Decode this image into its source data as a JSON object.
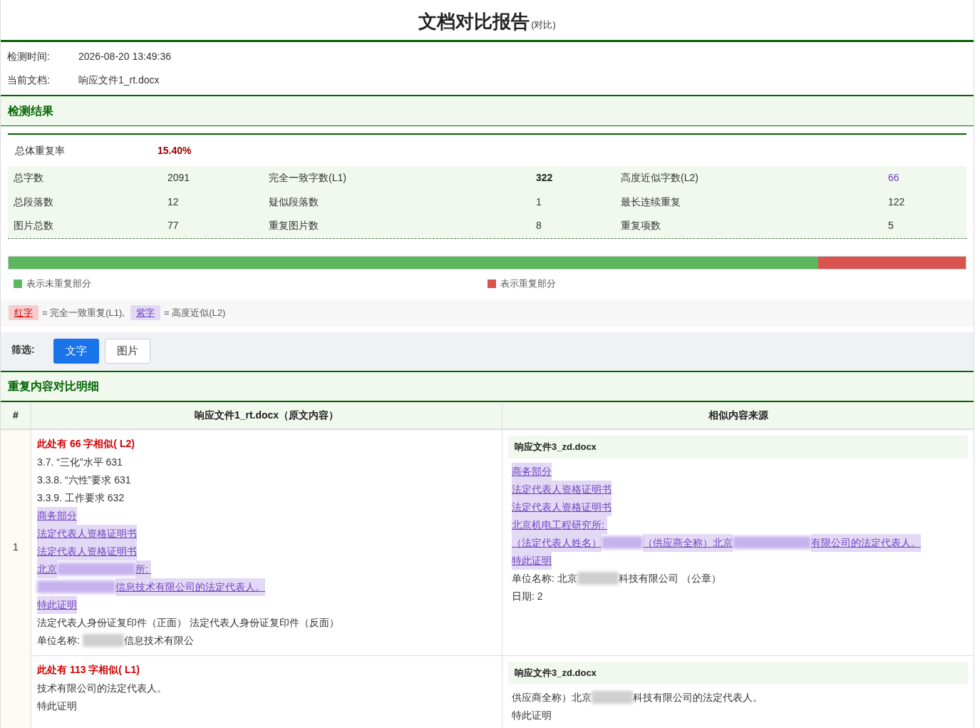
{
  "title": "文档对比报告",
  "title_note": "(对比)",
  "meta": [
    {
      "label": "检测时间:",
      "value": "2026-08-20 13:49:36"
    },
    {
      "label": "当前文档:",
      "value": "响应文件1_rt.docx"
    }
  ],
  "result_section": {
    "title": "检测结果"
  },
  "overall": {
    "label": "总体重复率",
    "value": "15.40%"
  },
  "stats": [
    [
      {
        "label": "总字数",
        "value": "2091",
        "kind": "plain"
      },
      {
        "label": "完全一致字数(L1)",
        "value": "322",
        "kind": "l1"
      },
      {
        "label": "高度近似字数(L2)",
        "value": "66",
        "kind": "l2"
      }
    ],
    [
      {
        "label": "总段落数",
        "value": "12",
        "kind": "plain"
      },
      {
        "label": "疑似段落数",
        "value": "1",
        "kind": "plain"
      },
      {
        "label": "最长连续重复",
        "value": "122",
        "kind": "plain"
      }
    ],
    [
      {
        "label": "图片总数",
        "value": "77",
        "kind": "plain"
      },
      {
        "label": "重复图片数",
        "value": "8",
        "kind": "plain"
      },
      {
        "label": "重复项数",
        "value": "5",
        "kind": "plain"
      }
    ]
  ],
  "bar": {
    "level": 0.846,
    "legend": [
      {
        "label": "表示未重复部分",
        "color": "#5cb85c"
      },
      {
        "label": "表示重复部分",
        "color": "#d9534f"
      }
    ]
  },
  "key": [
    {
      "kind": "l1",
      "sample": "红字",
      "meaning": "= 完全一致重复(L1),"
    },
    {
      "kind": "l2",
      "sample": "紫字",
      "meaning": "= 高度近似(L2)"
    }
  ],
  "filter": {
    "label": "筛选:",
    "options": [
      {
        "label": "文字",
        "selected": true
      },
      {
        "label": "图片",
        "selected": false
      }
    ]
  },
  "detail_section": {
    "title": "重复内容对比明细"
  },
  "table": {
    "columns": [
      "#",
      "响应文件1_rt.docx（原文内容）",
      "相似内容来源"
    ],
    "rows": [
      {
        "index": "1",
        "matches": [
          {
            "heading": "此处有 66 字相似( L2)",
            "lines": [
              {
                "kind": "plain",
                "segments": [
                  {
                    "kind": "text",
                    "text": "3.7. “三化”水平 631"
                  }
                ]
              },
              {
                "kind": "plain",
                "segments": [
                  {
                    "kind": "text",
                    "text": "3.3.8. “六性”要求 631"
                  }
                ]
              },
              {
                "kind": "plain",
                "segments": [
                  {
                    "kind": "text",
                    "text": "3.3.9. 工作要求 632"
                  }
                ]
              },
              {
                "kind": "l2",
                "segments": [
                  {
                    "kind": "text",
                    "text": "商务部分"
                  }
                ]
              },
              {
                "kind": "l2",
                "segments": [
                  {
                    "kind": "text",
                    "text": "法定代表人资格证明书"
                  }
                ]
              },
              {
                "kind": "l2",
                "segments": [
                  {
                    "kind": "text",
                    "text": "法定代表人资格证明书"
                  }
                ]
              },
              {
                "kind": "l2",
                "segments": [
                  {
                    "kind": "text",
                    "text": "北京"
                  },
                  {
                    "kind": "redactedwide"
                  },
                  {
                    "kind": "text",
                    "text": "所: "
                  }
                ]
              },
              {
                "kind": "l2",
                "segments": [
                  {
                    "kind": "redactedwide"
                  },
                  {
                    "kind": "text",
                    "text": "信息技术有限公司的法定代表人。"
                  }
                ]
              },
              {
                "kind": "l2",
                "segments": [
                  {
                    "kind": "text",
                    "text": "特此证明"
                  }
                ]
              },
              {
                "kind": "plain",
                "segments": [
                  {
                    "kind": "text",
                    "text": "法定代表人身份证复印件（正面） 法定代表人身份证复印件（反面）"
                  }
                ]
              },
              {
                "kind": "plain",
                "segments": [
                  {
                    "kind": "text",
                    "text": "单位名称: "
                  },
                  {
                    "kind": "redacted"
                  },
                  {
                    "kind": "text",
                    "text": "信息技术有限公"
                  }
                ]
              }
            ],
            "source": {
              "file": "响应文件3_zd.docx",
              "lines": [
                {
                  "kind": "l2",
                  "segments": [
                    {
                      "kind": "text",
                      "text": "商务部分"
                    }
                  ]
                },
                {
                  "kind": "l2",
                  "segments": [
                    {
                      "kind": "text",
                      "text": "法定代表人资格证明书"
                    }
                  ]
                },
                {
                  "kind": "l2",
                  "segments": [
                    {
                      "kind": "text",
                      "text": "法定代表人资格证明书"
                    }
                  ]
                },
                {
                  "kind": "l2",
                  "segments": [
                    {
                      "kind": "text",
                      "text": "北京机电工程研究所: "
                    }
                  ]
                },
                {
                  "kind": "l2",
                  "segments": [
                    {
                      "kind": "text",
                      "text": "（法定代表人姓名）"
                    },
                    {
                      "kind": "redacted"
                    },
                    {
                      "kind": "text",
                      "text": "（供应商全称）北京"
                    },
                    {
                      "kind": "redactedwide"
                    },
                    {
                      "kind": "text",
                      "text": "有限公司的法定代表人。"
                    }
                  ]
                },
                {
                  "kind": "l2",
                  "segments": [
                    {
                      "kind": "text",
                      "text": "特此证明"
                    }
                  ]
                },
                {
                  "kind": "plain",
                  "segments": [
                    {
                      "kind": "text",
                      "text": "单位名称: 北京"
                    },
                    {
                      "kind": "redacted"
                    },
                    {
                      "kind": "text",
                      "text": "科技有限公司 （公章）"
                    }
                  ]
                },
                {
                  "kind": "plain",
                  "segments": [
                    {
                      "kind": "text",
                      "text": "日期: 2"
                    }
                  ]
                }
              ]
            }
          },
          {
            "heading": "此处有 113 字相似( L1)",
            "lines": [
              {
                "kind": "plain",
                "segments": [
                  {
                    "kind": "text",
                    "text": "技术有限公司的法定代表人。"
                  }
                ]
              },
              {
                "kind": "plain",
                "segments": [
                  {
                    "kind": "text",
                    "text": "特此证明"
                  }
                ]
              }
            ],
            "source": {
              "file": "响应文件3_zd.docx",
              "lines": [
                {
                  "kind": "plain",
                  "segments": [
                    {
                      "kind": "text",
                      "text": "供应商全称）北京"
                    },
                    {
                      "kind": "redacted"
                    },
                    {
                      "kind": "text",
                      "text": "科技有限公司的法定代表人。"
                    }
                  ]
                },
                {
                  "kind": "plain",
                  "segments": [
                    {
                      "kind": "text",
                      "text": "特此证明"
                    }
                  ]
                }
              ]
            }
          }
        ]
      }
    ]
  }
}
